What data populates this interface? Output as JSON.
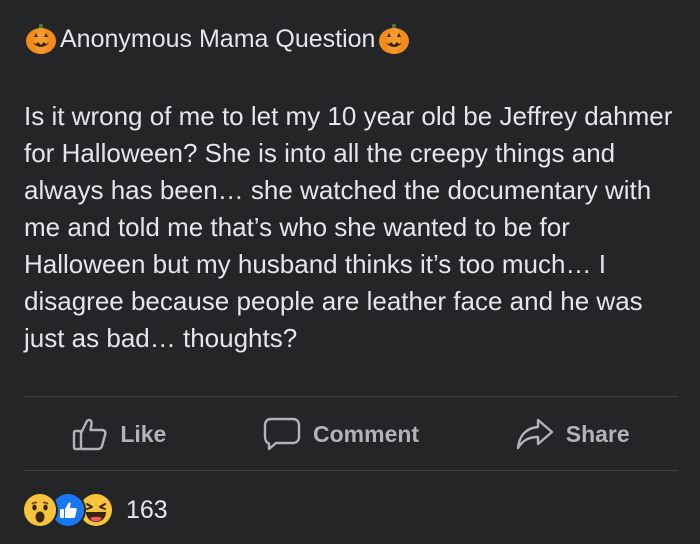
{
  "post": {
    "title": "Anonymous Mama Question",
    "body": "Is it wrong of me to let my 10 year old be Jeffrey dahmer for Halloween? She is into all the creepy things and always has been… she watched the documentary with me and told me that’s who she wanted to be for Halloween but my husband thinks it’s too much… I disagree because people are leather face and he was just as bad… thoughts?"
  },
  "actions": {
    "like_label": "Like",
    "comment_label": "Comment",
    "share_label": "Share"
  },
  "reactions": {
    "icons": [
      "wow-emoji",
      "like-emoji",
      "haha-emoji"
    ],
    "count": "163"
  },
  "colors": {
    "background": "#242526",
    "text": "#e4e6eb",
    "muted": "#b0b3b8",
    "divider": "#3e4042",
    "like_blue": "#1877f2",
    "emoji_yellow": "#f7c43c"
  }
}
